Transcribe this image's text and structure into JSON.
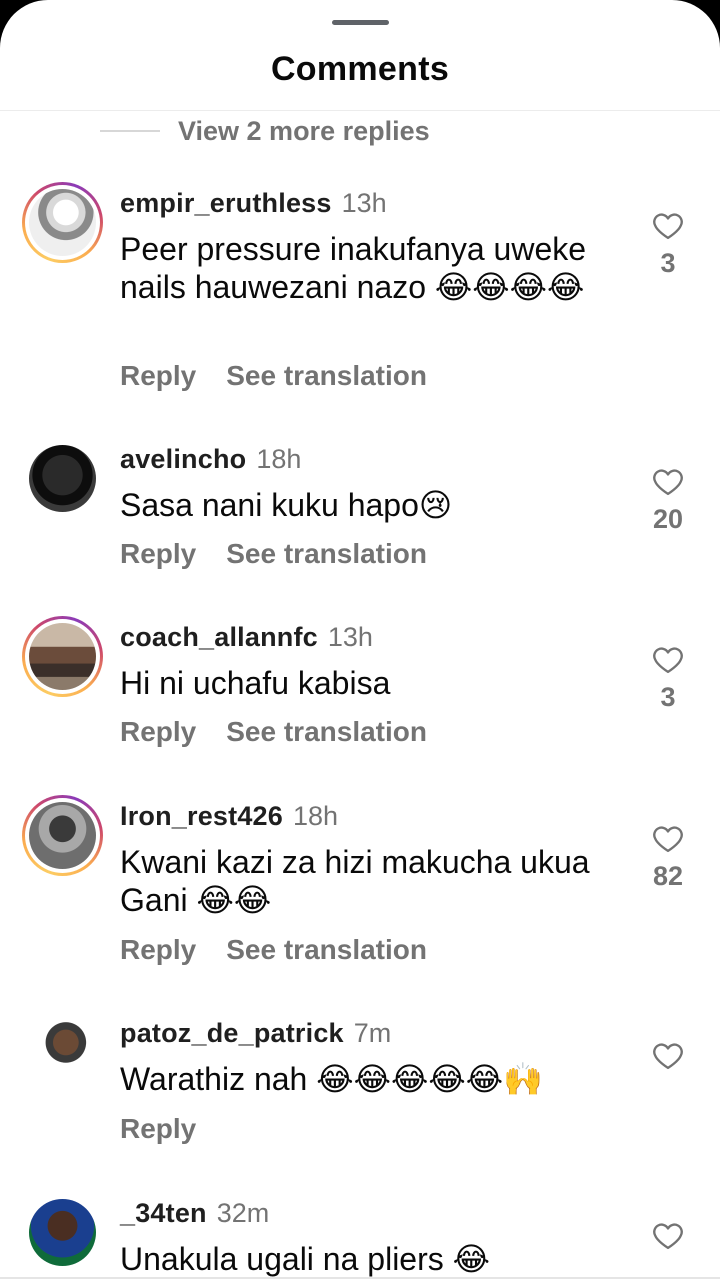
{
  "header": {
    "title": "Comments"
  },
  "view_more": {
    "label": "View 2 more replies"
  },
  "actions": {
    "reply": "Reply",
    "see_translation": "See translation"
  },
  "comments": [
    {
      "username": "empir_eruthless",
      "time": "13h",
      "text": "Peer pressure inakufanya uweke nails hauwezani nazo 😂😂😂😂",
      "likes": "3",
      "story_ring": true
    },
    {
      "username": "avelincho",
      "time": "18h",
      "text": "Sasa nani kuku hapo😢",
      "likes": "20",
      "story_ring": false
    },
    {
      "username": "coach_allannfc",
      "time": "13h",
      "text": "Hi ni uchafu kabisa",
      "likes": "3",
      "story_ring": true
    },
    {
      "username": "Iron_rest426",
      "time": "18h",
      "text": "Kwani kazi za hizi makucha ukua Gani 😂😂",
      "likes": "82",
      "story_ring": true
    },
    {
      "username": "patoz_de_patrick",
      "time": "7m",
      "text": "Warathiz nah 😂😂😂😂😂🙌",
      "likes": "",
      "story_ring": false
    },
    {
      "username": "_34ten",
      "time": "32m",
      "text": "Unakula ugali na pliers 😂",
      "likes": "",
      "story_ring": false
    }
  ]
}
